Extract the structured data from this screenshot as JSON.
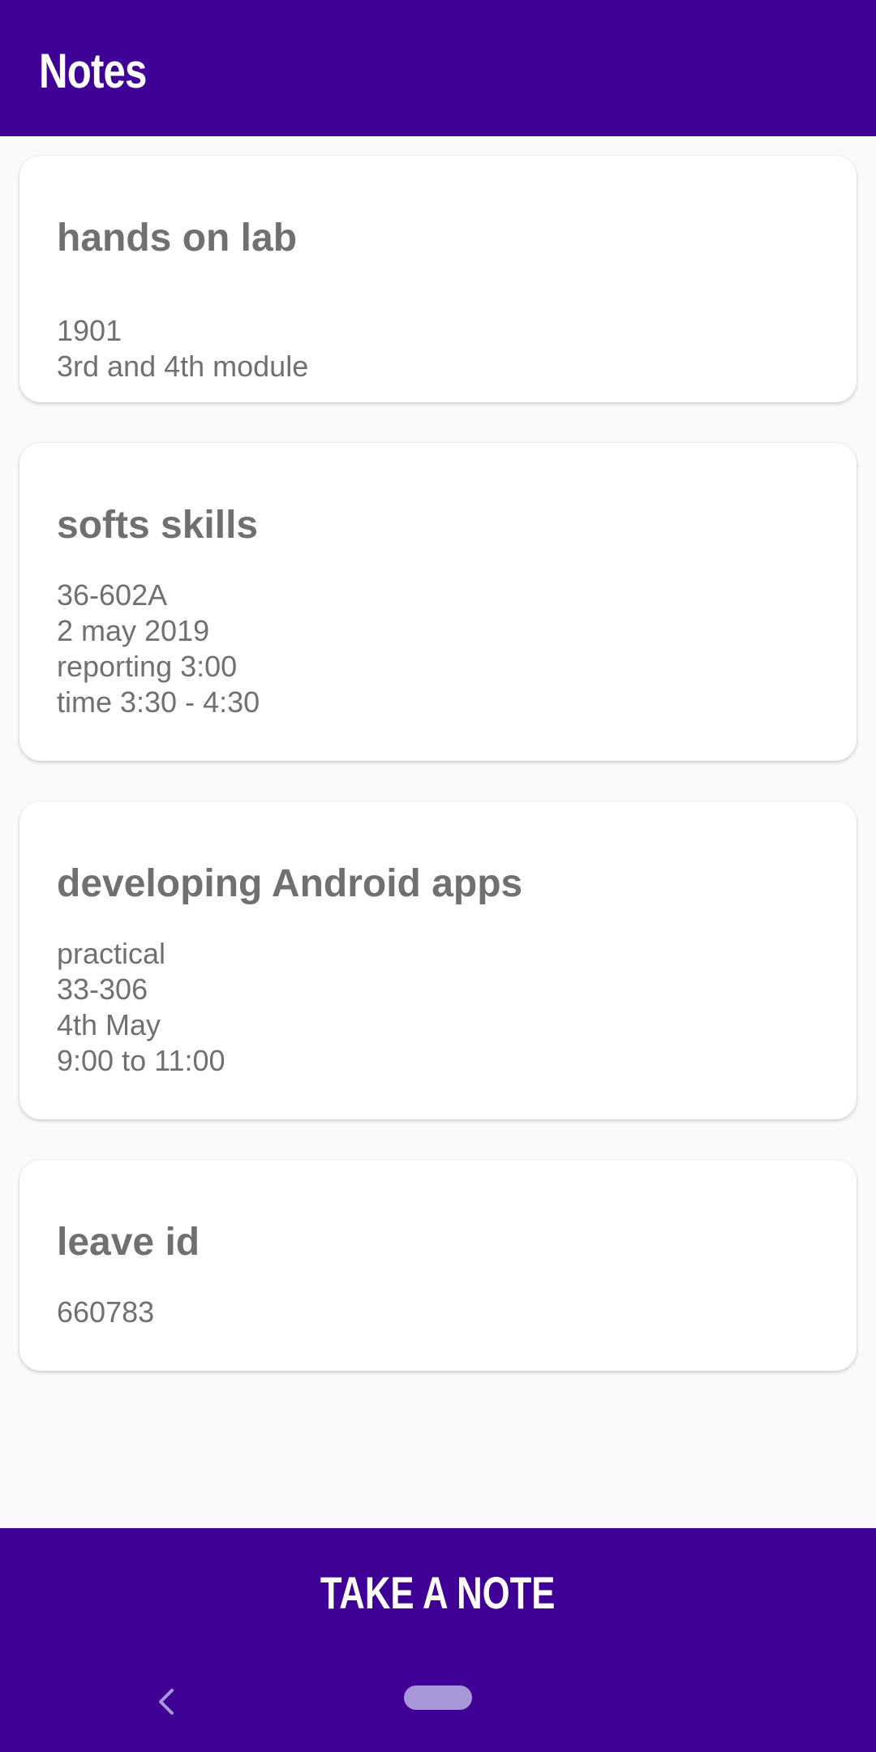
{
  "app_bar": {
    "title": "Notes",
    "background": "#3f0095"
  },
  "notes": [
    {
      "title": "hands on lab",
      "body": "1901\n3rd and 4th module"
    },
    {
      "title": "softs skills",
      "body": "36-602A\n2 may 2019\nreporting 3:00\ntime 3:30 - 4:30"
    },
    {
      "title": "developing Android apps",
      "body": "practical\n33-306\n4th May\n9:00 to 11:00"
    },
    {
      "title": "leave id",
      "body": "660783"
    }
  ],
  "bottom_bar": {
    "take_note_label": "TAKE A NOTE",
    "background": "#3f0095"
  },
  "system_nav": {
    "back_icon": "chevron-left-icon",
    "home_icon": "home-pill-icon",
    "home_color": "#a998d8"
  }
}
